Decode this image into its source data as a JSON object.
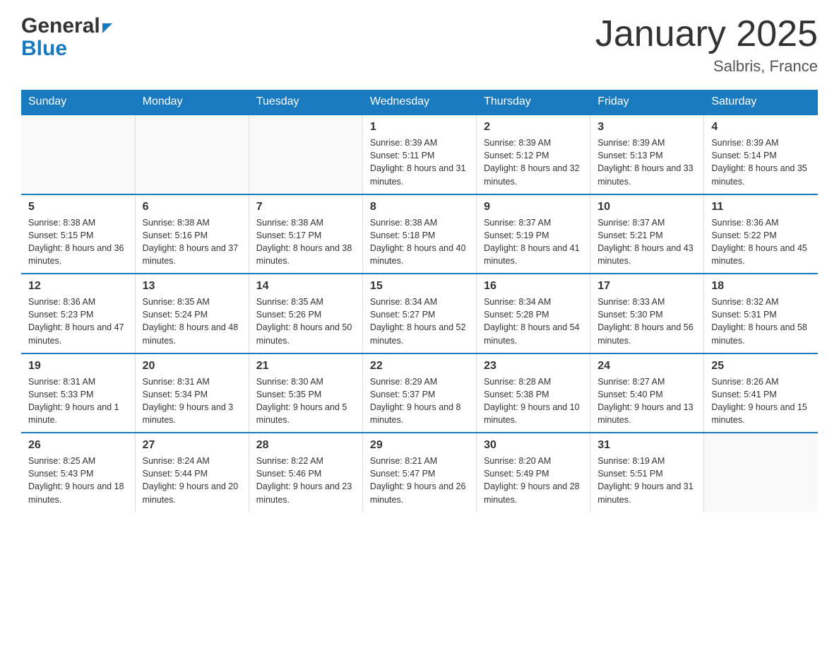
{
  "header": {
    "logo_text_black": "General",
    "logo_text_blue": "Blue",
    "title": "January 2025",
    "subtitle": "Salbris, France"
  },
  "days_of_week": [
    "Sunday",
    "Monday",
    "Tuesday",
    "Wednesday",
    "Thursday",
    "Friday",
    "Saturday"
  ],
  "weeks": [
    [
      {
        "day": "",
        "info": ""
      },
      {
        "day": "",
        "info": ""
      },
      {
        "day": "",
        "info": ""
      },
      {
        "day": "1",
        "info": "Sunrise: 8:39 AM\nSunset: 5:11 PM\nDaylight: 8 hours\nand 31 minutes."
      },
      {
        "day": "2",
        "info": "Sunrise: 8:39 AM\nSunset: 5:12 PM\nDaylight: 8 hours\nand 32 minutes."
      },
      {
        "day": "3",
        "info": "Sunrise: 8:39 AM\nSunset: 5:13 PM\nDaylight: 8 hours\nand 33 minutes."
      },
      {
        "day": "4",
        "info": "Sunrise: 8:39 AM\nSunset: 5:14 PM\nDaylight: 8 hours\nand 35 minutes."
      }
    ],
    [
      {
        "day": "5",
        "info": "Sunrise: 8:38 AM\nSunset: 5:15 PM\nDaylight: 8 hours\nand 36 minutes."
      },
      {
        "day": "6",
        "info": "Sunrise: 8:38 AM\nSunset: 5:16 PM\nDaylight: 8 hours\nand 37 minutes."
      },
      {
        "day": "7",
        "info": "Sunrise: 8:38 AM\nSunset: 5:17 PM\nDaylight: 8 hours\nand 38 minutes."
      },
      {
        "day": "8",
        "info": "Sunrise: 8:38 AM\nSunset: 5:18 PM\nDaylight: 8 hours\nand 40 minutes."
      },
      {
        "day": "9",
        "info": "Sunrise: 8:37 AM\nSunset: 5:19 PM\nDaylight: 8 hours\nand 41 minutes."
      },
      {
        "day": "10",
        "info": "Sunrise: 8:37 AM\nSunset: 5:21 PM\nDaylight: 8 hours\nand 43 minutes."
      },
      {
        "day": "11",
        "info": "Sunrise: 8:36 AM\nSunset: 5:22 PM\nDaylight: 8 hours\nand 45 minutes."
      }
    ],
    [
      {
        "day": "12",
        "info": "Sunrise: 8:36 AM\nSunset: 5:23 PM\nDaylight: 8 hours\nand 47 minutes."
      },
      {
        "day": "13",
        "info": "Sunrise: 8:35 AM\nSunset: 5:24 PM\nDaylight: 8 hours\nand 48 minutes."
      },
      {
        "day": "14",
        "info": "Sunrise: 8:35 AM\nSunset: 5:26 PM\nDaylight: 8 hours\nand 50 minutes."
      },
      {
        "day": "15",
        "info": "Sunrise: 8:34 AM\nSunset: 5:27 PM\nDaylight: 8 hours\nand 52 minutes."
      },
      {
        "day": "16",
        "info": "Sunrise: 8:34 AM\nSunset: 5:28 PM\nDaylight: 8 hours\nand 54 minutes."
      },
      {
        "day": "17",
        "info": "Sunrise: 8:33 AM\nSunset: 5:30 PM\nDaylight: 8 hours\nand 56 minutes."
      },
      {
        "day": "18",
        "info": "Sunrise: 8:32 AM\nSunset: 5:31 PM\nDaylight: 8 hours\nand 58 minutes."
      }
    ],
    [
      {
        "day": "19",
        "info": "Sunrise: 8:31 AM\nSunset: 5:33 PM\nDaylight: 9 hours\nand 1 minute."
      },
      {
        "day": "20",
        "info": "Sunrise: 8:31 AM\nSunset: 5:34 PM\nDaylight: 9 hours\nand 3 minutes."
      },
      {
        "day": "21",
        "info": "Sunrise: 8:30 AM\nSunset: 5:35 PM\nDaylight: 9 hours\nand 5 minutes."
      },
      {
        "day": "22",
        "info": "Sunrise: 8:29 AM\nSunset: 5:37 PM\nDaylight: 9 hours\nand 8 minutes."
      },
      {
        "day": "23",
        "info": "Sunrise: 8:28 AM\nSunset: 5:38 PM\nDaylight: 9 hours\nand 10 minutes."
      },
      {
        "day": "24",
        "info": "Sunrise: 8:27 AM\nSunset: 5:40 PM\nDaylight: 9 hours\nand 13 minutes."
      },
      {
        "day": "25",
        "info": "Sunrise: 8:26 AM\nSunset: 5:41 PM\nDaylight: 9 hours\nand 15 minutes."
      }
    ],
    [
      {
        "day": "26",
        "info": "Sunrise: 8:25 AM\nSunset: 5:43 PM\nDaylight: 9 hours\nand 18 minutes."
      },
      {
        "day": "27",
        "info": "Sunrise: 8:24 AM\nSunset: 5:44 PM\nDaylight: 9 hours\nand 20 minutes."
      },
      {
        "day": "28",
        "info": "Sunrise: 8:22 AM\nSunset: 5:46 PM\nDaylight: 9 hours\nand 23 minutes."
      },
      {
        "day": "29",
        "info": "Sunrise: 8:21 AM\nSunset: 5:47 PM\nDaylight: 9 hours\nand 26 minutes."
      },
      {
        "day": "30",
        "info": "Sunrise: 8:20 AM\nSunset: 5:49 PM\nDaylight: 9 hours\nand 28 minutes."
      },
      {
        "day": "31",
        "info": "Sunrise: 8:19 AM\nSunset: 5:51 PM\nDaylight: 9 hours\nand 31 minutes."
      },
      {
        "day": "",
        "info": ""
      }
    ]
  ]
}
